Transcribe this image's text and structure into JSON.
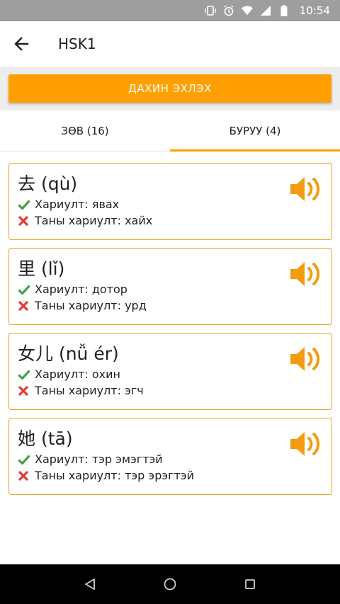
{
  "status_bar": {
    "time": "10:54"
  },
  "app_bar": {
    "title": "HSK1"
  },
  "restart_button": {
    "label": "ДАХИН ЭХЛЭХ"
  },
  "tabs": [
    {
      "label": "ЗӨВ (16)",
      "active": false
    },
    {
      "label": "БУРУУ (4)",
      "active": true
    }
  ],
  "cards": [
    {
      "word": "去 (qù)",
      "answer": "Хариулт: явах",
      "your_answer": "Таны хариулт: хайх"
    },
    {
      "word": "里 (lǐ)",
      "answer": "Хариулт: дотор",
      "your_answer": "Таны хариулт: урд"
    },
    {
      "word": "女儿 (nǚ ér)",
      "answer": "Хариулт: охин",
      "your_answer": "Таны хариулт: эгч"
    },
    {
      "word": "她 (tā)",
      "answer": "Хариулт: тэр эмэгтэй",
      "your_answer": "Таны хариулт: тэр эрэгтэй"
    }
  ],
  "colors": {
    "accent": "#ffa000",
    "correct": "#43a047",
    "wrong": "#e53935",
    "status_bar": "#9e9e9e"
  },
  "icons": [
    "back-arrow-icon",
    "speaker-icon",
    "check-icon",
    "cross-icon",
    "nav-back-icon",
    "nav-home-icon",
    "nav-recents-icon"
  ]
}
